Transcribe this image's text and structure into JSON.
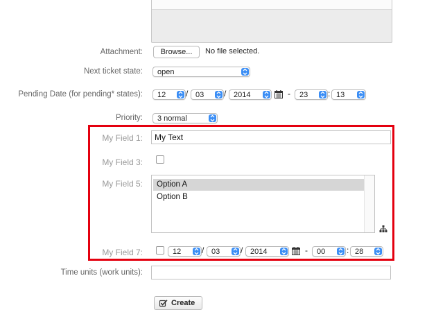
{
  "form": {
    "attachment": {
      "label": "Attachment:",
      "browse_label": "Browse...",
      "status": "No file selected."
    },
    "next_state": {
      "label": "Next ticket state:",
      "value": "open"
    },
    "pending_date": {
      "label": "Pending Date (for pending* states):",
      "day": "12",
      "month": "03",
      "year": "2014",
      "hour": "23",
      "minute": "13",
      "slash": "/",
      "dash": "-",
      "colon": ":"
    },
    "priority": {
      "label": "Priority:",
      "value": "3 normal"
    },
    "field1": {
      "label": "My Field 1:",
      "value": "My Text"
    },
    "field3": {
      "label": "My Field 3:",
      "checked": false
    },
    "field5": {
      "label": "My Field 5:",
      "options": [
        "Option A",
        "Option B"
      ],
      "selected": "Option A"
    },
    "field7": {
      "label": "My Field 7:",
      "checked": false,
      "day": "12",
      "month": "03",
      "year": "2014",
      "hour": "00",
      "minute": "28",
      "slash": "/",
      "dash": "-",
      "colon": ":"
    },
    "time_units": {
      "label": "Time units (work units):",
      "value": ""
    },
    "create_label": "Create"
  },
  "icons": {
    "calendar": "calendar-icon",
    "tree": "tree-select-icon",
    "check": "checkmark-icon",
    "select_arrow": "select-arrow-icon"
  },
  "colors": {
    "highlight_border": "#e4000f",
    "select_arrow_bg": "#3b8ef5",
    "label_text": "#666666",
    "listbox_selected": "#d6d6d6"
  }
}
